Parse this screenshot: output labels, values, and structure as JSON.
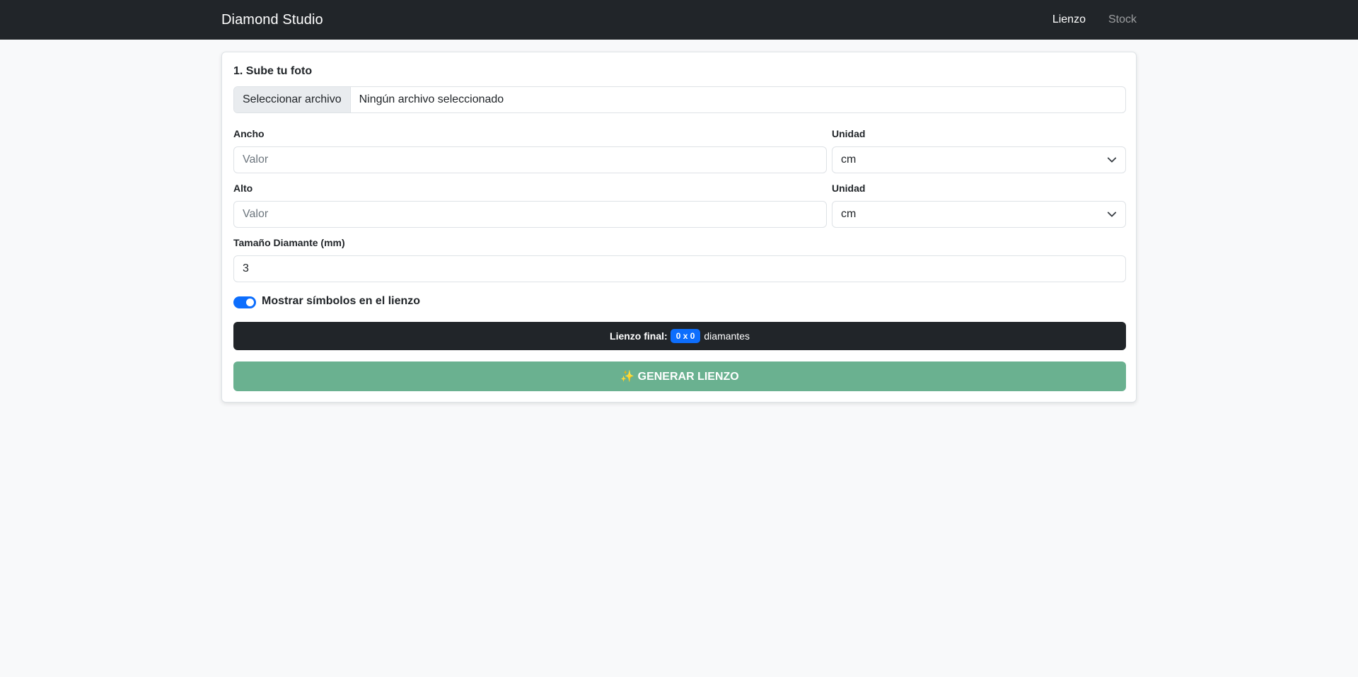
{
  "navbar": {
    "brand": "Diamond Studio",
    "links": [
      {
        "label": "Lienzo",
        "active": true
      },
      {
        "label": "Stock",
        "active": false
      }
    ]
  },
  "form": {
    "section_title": "1. Sube tu foto",
    "file_input": {
      "button_label": "Seleccionar archivo",
      "status": "Ningún archivo seleccionado"
    },
    "width": {
      "label": "Ancho",
      "placeholder": "Valor",
      "value": ""
    },
    "width_unit": {
      "label": "Unidad",
      "selected": "cm"
    },
    "height": {
      "label": "Alto",
      "placeholder": "Valor",
      "value": ""
    },
    "height_unit": {
      "label": "Unidad",
      "selected": "cm"
    },
    "diamond_size": {
      "label": "Tamaño Diamante (mm)",
      "value": "3"
    },
    "show_symbols": {
      "label": "Mostrar símbolos en el lienzo",
      "checked": true
    },
    "canvas_info": {
      "label": "Lienzo final:",
      "badge": "0 x 0",
      "suffix": "diamantes"
    },
    "generate_button": {
      "icon": "sparkles-icon",
      "label": "✨ GENERAR LIENZO"
    }
  },
  "colors": {
    "navbar_bg": "#212529",
    "accent": "#0d6efd",
    "generate_button": "#6ab190",
    "page_bg": "#f8f9fa"
  }
}
